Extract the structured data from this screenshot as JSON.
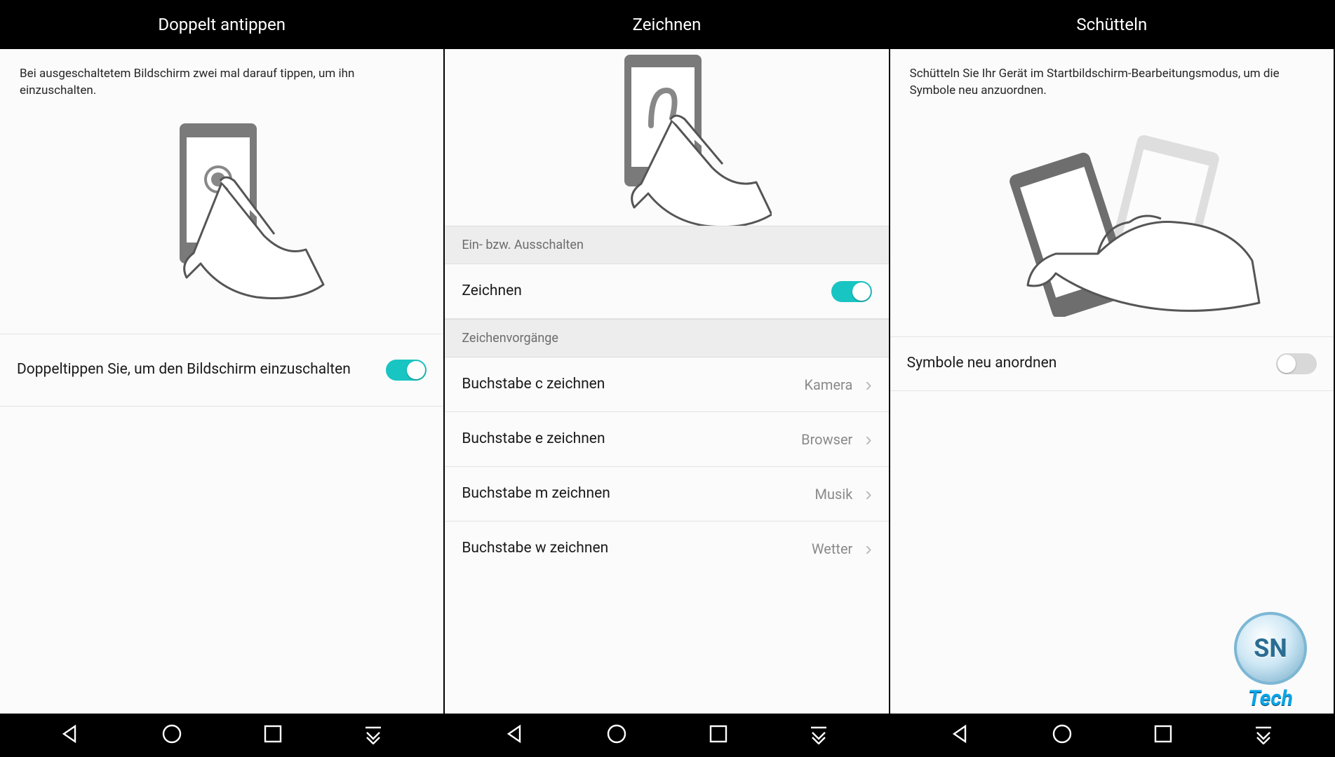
{
  "screens": [
    {
      "title": "Doppelt antippen",
      "description": "Bei ausgeschaltetem Bildschirm zwei mal darauf tippen, um ihn einzuschalten.",
      "toggle": {
        "label": "Doppeltippen Sie, um den Bildschirm einzuschalten",
        "on": true
      }
    },
    {
      "title": "Zeichnen",
      "section_on_off": "Ein- bzw. Ausschalten",
      "main_toggle": {
        "label": "Zeichnen",
        "on": true
      },
      "section_ops": "Zeichenvorgänge",
      "ops": [
        {
          "label": "Buchstabe c zeichnen",
          "value": "Kamera"
        },
        {
          "label": "Buchstabe e zeichnen",
          "value": "Browser"
        },
        {
          "label": "Buchstabe m zeichnen",
          "value": "Musik"
        },
        {
          "label": "Buchstabe w zeichnen",
          "value": "Wetter"
        }
      ]
    },
    {
      "title": "Schütteln",
      "description": "Schütteln Sie Ihr Gerät im Startbildschirm-Bearbeitungsmodus, um die Symbole neu anzuordnen.",
      "toggle": {
        "label": "Symbole neu anordnen",
        "on": false
      }
    }
  ],
  "watermark": {
    "initials": "SN",
    "text": "Tech"
  }
}
